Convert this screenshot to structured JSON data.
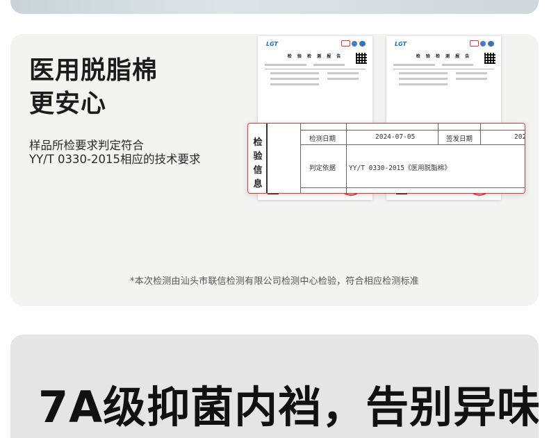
{
  "headline": {
    "line1": "医用脱脂棉",
    "line2": "更安心"
  },
  "subtext": {
    "line1": "样品所检要求判定符合",
    "line2": "YY/T 0330-2015相应的技术要求"
  },
  "report": {
    "logo": "LGT",
    "title": "检 验 检 测 报 告"
  },
  "zoom_table": {
    "category_chars": [
      "检",
      "验",
      "信",
      "息"
    ],
    "date_label": "检测日期",
    "date_value": "2024-07-05",
    "sign_date_label": "签发日期",
    "sign_date_value": "202",
    "basis_label": "判定依据",
    "basis_value": "YY/T 0330-2015《医用脱脂棉》"
  },
  "footnote": "*本次检测由汕头市联信检测有限公司检测中心检验，符合相应检测标准",
  "next_section": {
    "headline_line1": "7A级抑菌内裆，告别异味",
    "headline_line2_partial": ""
  },
  "colors": {
    "accent_red": "#d9363e",
    "card_bg": "#f3f3f2",
    "card2_bg": "#e5e5e5"
  }
}
